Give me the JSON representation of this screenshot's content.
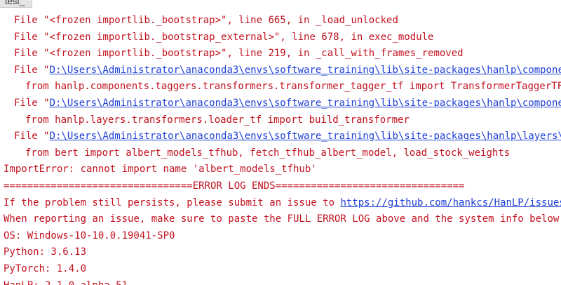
{
  "tab": {
    "label": "test_"
  },
  "traceback": [
    {
      "prefix": "File \"",
      "path": "<frozen importlib._bootstrap>",
      "suffix": "\", line 665, in _load_unlocked",
      "is_link": false
    },
    {
      "prefix": "File \"",
      "path": "<frozen importlib._bootstrap_external>",
      "suffix": "\", line 678, in exec_module",
      "is_link": false
    },
    {
      "prefix": "File \"",
      "path": "<frozen importlib._bootstrap>",
      "suffix": "\", line 219, in _call_with_frames_removed",
      "is_link": false
    },
    {
      "prefix": "File \"",
      "path": "D:\\Users\\Administrator\\anaconda3\\envs\\software_training\\lib\\site-packages\\hanlp\\components\\taggers\\transformers\\transformer_tagger_tf.py",
      "suffix": "",
      "is_link": true
    },
    {
      "code": "from hanlp.components.taggers.transformers.transformer_tagger_tf import TransformerTaggerTF"
    },
    {
      "prefix": "File \"",
      "path": "D:\\Users\\Administrator\\anaconda3\\envs\\software_training\\lib\\site-packages\\hanlp\\components\\taggers\\transformers\\transformer_tagger_tf.py",
      "suffix": "",
      "is_link": true
    },
    {
      "code": "from hanlp.layers.transformers.loader_tf import build_transformer"
    },
    {
      "prefix": "File \"",
      "path": "D:\\Users\\Administrator\\anaconda3\\envs\\software_training\\lib\\site-packages\\hanlp\\layers\\transformers\\loader_tf.py",
      "suffix": "",
      "is_link": true
    },
    {
      "code": "from bert import albert_models_tfhub, fetch_tfhub_albert_model, load_stock_weights"
    }
  ],
  "error_line": "ImportError: cannot import name 'albert_models_tfhub'",
  "error_log_ends": "================================ERROR LOG ENDS================================",
  "persist_text": "If the problem still persists, please submit an issue to ",
  "issues_url": "https://github.com/hankcs/HanLP/issues",
  "report_text": "When reporting an issue, make sure to paste the FULL ERROR LOG above and the system info below.",
  "os_line": "OS: Windows-10-10.0.19041-SP0",
  "python_line": "Python: 3.6.13",
  "pytorch_line": "PyTorch: 1.4.0",
  "hanlp_line": "HanLP: 2.1.0-alpha.51"
}
